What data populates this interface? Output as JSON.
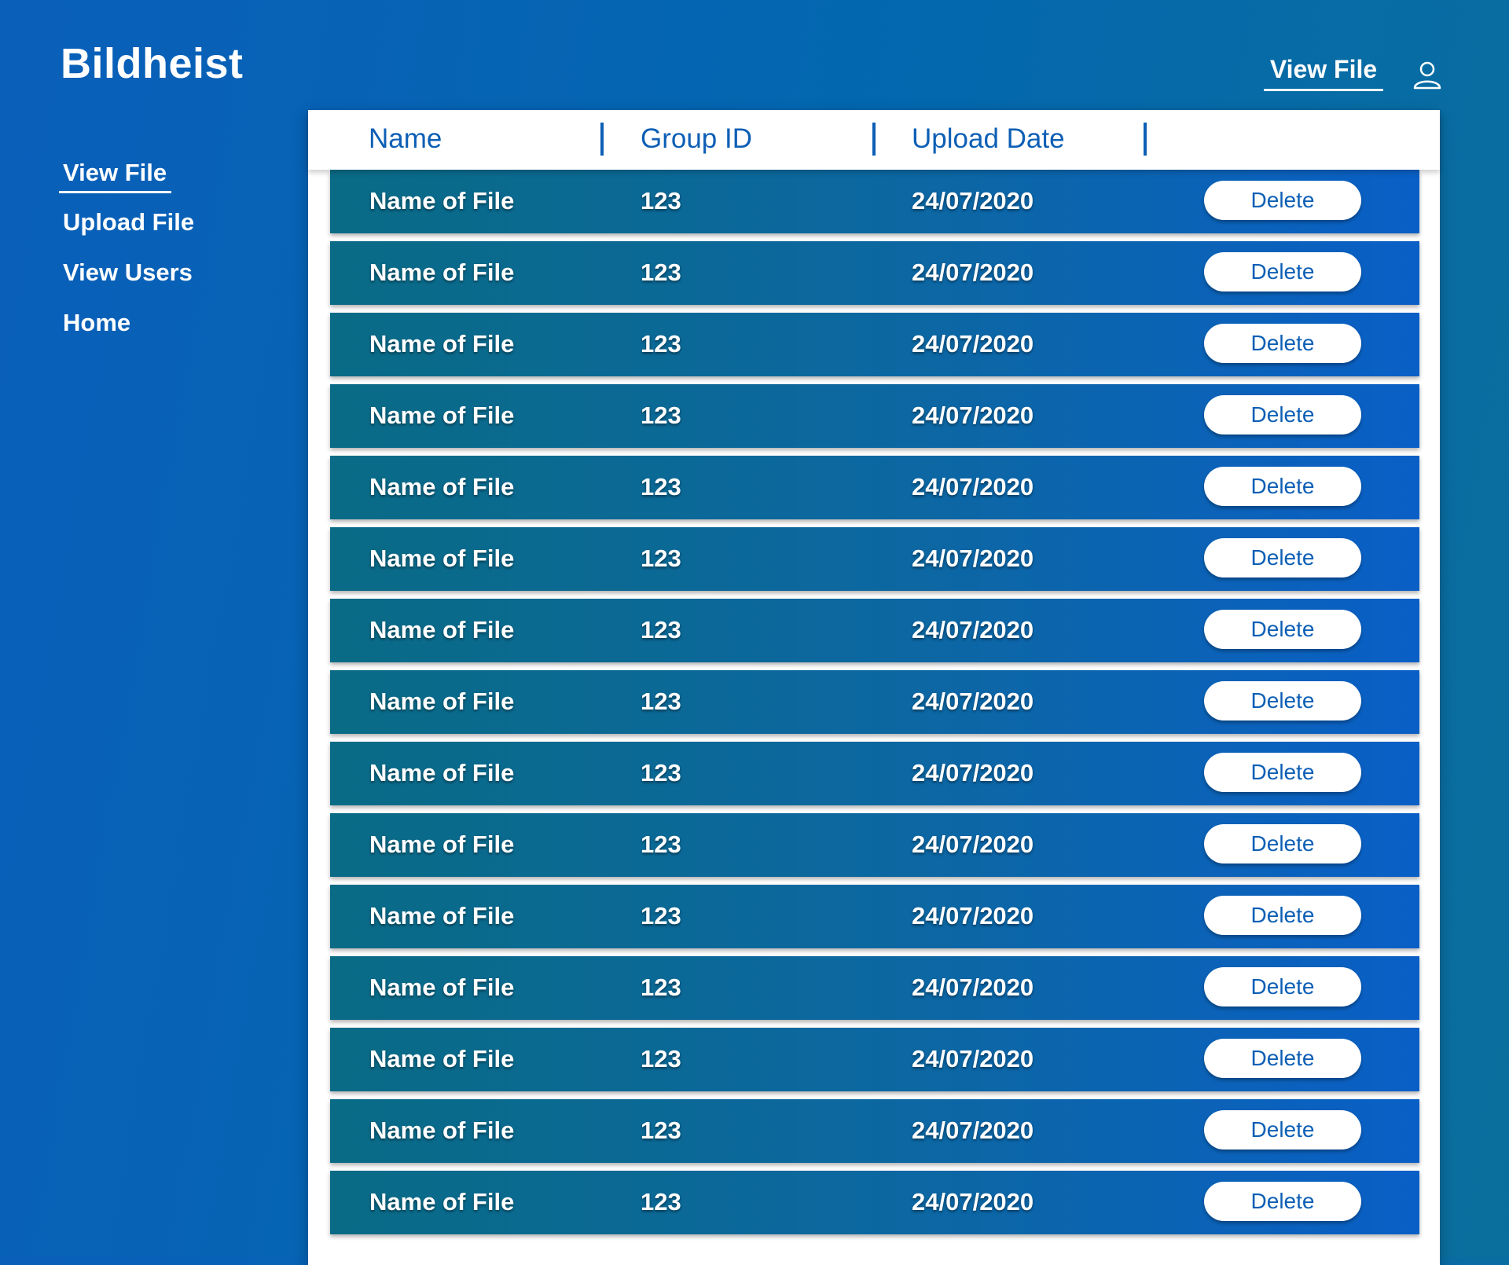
{
  "app": {
    "brand": "Bildheist"
  },
  "topbar": {
    "link_label": "View File",
    "user_icon": "user-icon"
  },
  "sidebar": {
    "items": [
      {
        "label": "View File",
        "active": true
      },
      {
        "label": "Upload File",
        "active": false
      },
      {
        "label": "View Users",
        "active": false
      },
      {
        "label": "Home",
        "active": false
      }
    ]
  },
  "table": {
    "columns": [
      "Name",
      "Group ID",
      "Upload Date"
    ],
    "delete_label": "Delete",
    "rows": [
      {
        "name": "Name of File",
        "group_id": "123",
        "upload_date": "24/07/2020"
      },
      {
        "name": "Name of File",
        "group_id": "123",
        "upload_date": "24/07/2020"
      },
      {
        "name": "Name of File",
        "group_id": "123",
        "upload_date": "24/07/2020"
      },
      {
        "name": "Name of File",
        "group_id": "123",
        "upload_date": "24/07/2020"
      },
      {
        "name": "Name of File",
        "group_id": "123",
        "upload_date": "24/07/2020"
      },
      {
        "name": "Name of File",
        "group_id": "123",
        "upload_date": "24/07/2020"
      },
      {
        "name": "Name of File",
        "group_id": "123",
        "upload_date": "24/07/2020"
      },
      {
        "name": "Name of File",
        "group_id": "123",
        "upload_date": "24/07/2020"
      },
      {
        "name": "Name of File",
        "group_id": "123",
        "upload_date": "24/07/2020"
      },
      {
        "name": "Name of File",
        "group_id": "123",
        "upload_date": "24/07/2020"
      },
      {
        "name": "Name of File",
        "group_id": "123",
        "upload_date": "24/07/2020"
      },
      {
        "name": "Name of File",
        "group_id": "123",
        "upload_date": "24/07/2020"
      },
      {
        "name": "Name of File",
        "group_id": "123",
        "upload_date": "24/07/2020"
      },
      {
        "name": "Name of File",
        "group_id": "123",
        "upload_date": "24/07/2020"
      },
      {
        "name": "Name of File",
        "group_id": "123",
        "upload_date": "24/07/2020"
      }
    ]
  },
  "colors": {
    "accent": "#0d5fb5",
    "row_start": "#0a6b86",
    "row_end": "#0a5fc6"
  }
}
